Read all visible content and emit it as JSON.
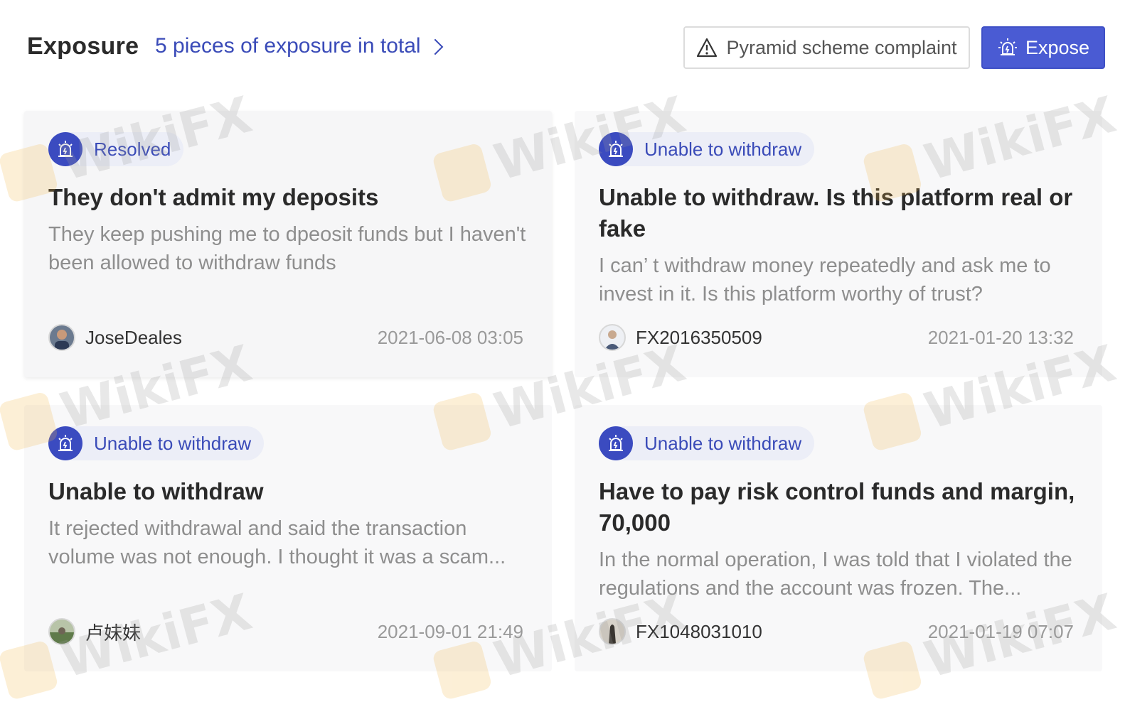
{
  "header": {
    "title": "Exposure",
    "summary_link": "5 pieces of exposure in total",
    "complaint_button": "Pyramid scheme complaint",
    "expose_button": "Expose"
  },
  "watermark_text": "WikiFX",
  "cards": [
    {
      "tag": "Resolved",
      "title": "They don't admit my deposits",
      "description": "They keep pushing me to dpeosit funds but I haven't been allowed to withdraw funds",
      "author": "JoseDeales",
      "date": "2021-06-08 03:05"
    },
    {
      "tag": "Unable to withdraw",
      "title": "Unable to withdraw. Is this platform real or fake",
      "description": "I can’ t withdraw money repeatedly and ask me to invest in it. Is this platform worthy of trust?",
      "author": "FX2016350509",
      "date": "2021-01-20 13:32"
    },
    {
      "tag": "Unable to withdraw",
      "title": "Unable to withdraw",
      "description": "It rejected withdrawal and said the transaction volume was not enough. I thought it was a scam...",
      "author": "卢妹妹",
      "date": "2021-09-01 21:49"
    },
    {
      "tag": "Unable to withdraw",
      "title": "Have to pay risk  control funds and margin, 70,000",
      "description": "In the normal operation, I was told that I violated the regulations and the account was frozen. The...",
      "author": "FX1048031010",
      "date": "2021-01-19 07:07"
    }
  ],
  "colors": {
    "accent": "#4a5bd3",
    "link": "#3a4bb8",
    "tag_bg": "#eceef7"
  }
}
